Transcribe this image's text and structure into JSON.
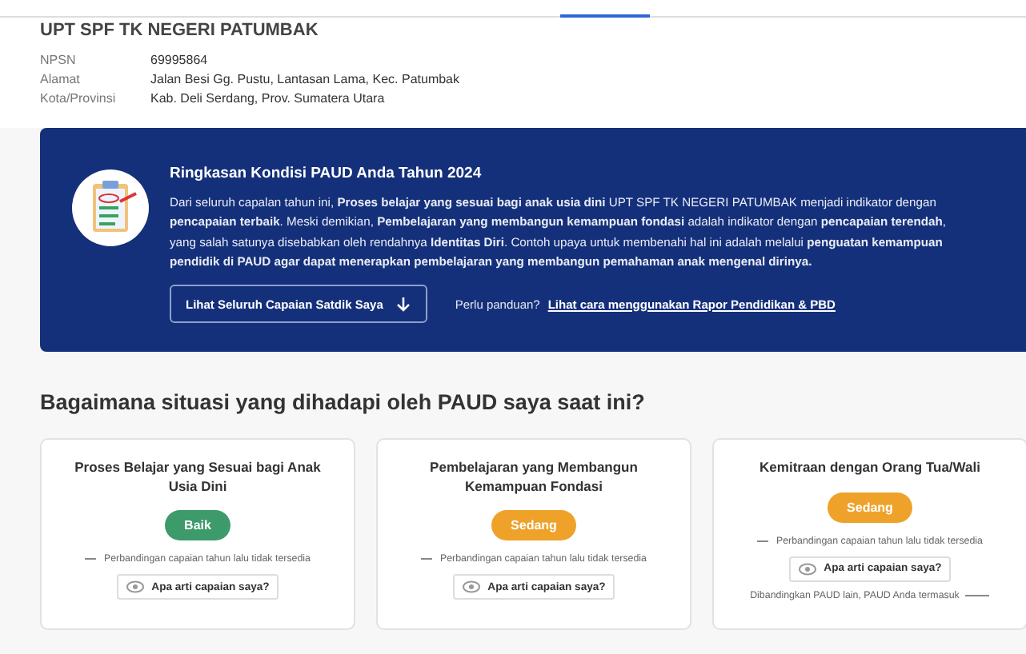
{
  "school": {
    "name": "UPT SPF TK NEGERI PATUMBAK",
    "fields": [
      {
        "label": "NPSN",
        "value": "69995864"
      },
      {
        "label": "Alamat",
        "value": "Jalan Besi Gg. Pustu, Lantasan Lama, Kec. Patumbak"
      },
      {
        "label": "Kota/Provinsi",
        "value": "Kab. Deli Serdang, Prov. Sumatera Utara"
      }
    ]
  },
  "summary": {
    "title": "Ringkasan Kondisi PAUD Anda Tahun 2024",
    "text": "Dari seluruh capalan tahun ini, **Proses belajar yang sesuai bagi anak usia dini** UPT SPF TK NEGERI PATUMBAK menjadi indikator dengan **pencapaian terbaik**. Meski demikian, **Pembelajaran yang membangun kemampuan fondasi** adalah indikator dengan **pencapaian terendah**, yang salah satunya disebabkan oleh rendahnya **Identitas Diri**. Contoh upaya untuk membenahi hal ini adalah melalui **penguatan kemampuan pendidik di PAUD agar dapat menerapkan pembelajaran yang membangun pemahaman anak mengenal dirinya.**",
    "button": "Lihat Seluruh Capaian Satdik Saya",
    "help_label": "Perlu panduan?",
    "help_link": "Lihat cara menggunakan Rapor Pendidikan & PBD"
  },
  "section_title": "Bagaimana situasi yang dihadapi oleh PAUD saya saat ini?",
  "cards": [
    {
      "title": "Proses Belajar yang Sesuai bagi Anak Usia Dini",
      "status": "Baik",
      "color": "#3d9a6b",
      "comparison": "Perbandingan capaian tahun lalu tidak tersedia",
      "info_button": "Apa arti capaian saya?"
    },
    {
      "title": "Pembelajaran yang Membangun Kemampuan Fondasi",
      "status": "Sedang",
      "color": "#eea22a",
      "comparison": "Perbandingan capaian tahun lalu tidak tersedia",
      "info_button": "Apa arti capaian saya?"
    },
    {
      "title": "Kemitraan dengan Orang Tua/Wali",
      "status": "Sedang",
      "color": "#eea22a",
      "comparison": "Perbandingan capaian tahun lalu tidak tersedia",
      "info_button": "Apa arti capaian saya?",
      "note": "Dibandingkan PAUD lain, PAUD Anda termasuk"
    }
  ]
}
